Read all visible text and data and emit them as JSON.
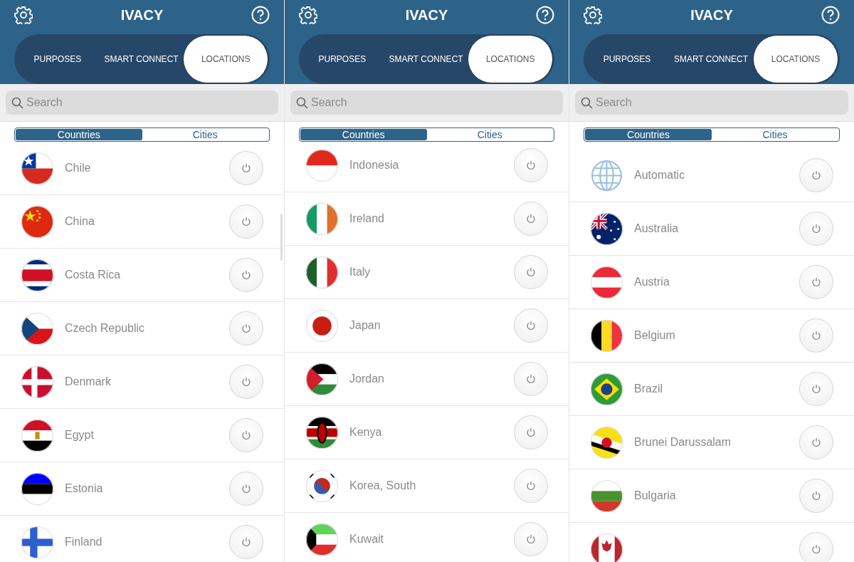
{
  "panels": [
    {
      "title": "IVACY",
      "modes": [
        {
          "label": "PURPOSES",
          "selected": false
        },
        {
          "label": "SMART CONNECT",
          "selected": false
        },
        {
          "label": "LOCATIONS",
          "selected": true
        }
      ],
      "search": {
        "placeholder": "Search"
      },
      "segments": [
        {
          "label": "Countries",
          "selected": true
        },
        {
          "label": "Cities",
          "selected": false
        }
      ],
      "scroll_indicator": true,
      "rows": [
        {
          "name": "Chile",
          "kind": "cl"
        },
        {
          "name": "China",
          "kind": "cn"
        },
        {
          "name": "Costa Rica",
          "kind": "cr"
        },
        {
          "name": "Czech Republic",
          "kind": "cz"
        },
        {
          "name": "Denmark",
          "kind": "dk"
        },
        {
          "name": "Egypt",
          "kind": "eg"
        },
        {
          "name": "Estonia",
          "kind": "ee"
        },
        {
          "name": "Finland",
          "kind": "fi"
        }
      ]
    },
    {
      "title": "IVACY",
      "modes": [
        {
          "label": "PURPOSES",
          "selected": false
        },
        {
          "label": "SMART CONNECT",
          "selected": false
        },
        {
          "label": "LOCATIONS",
          "selected": true
        }
      ],
      "search": {
        "placeholder": "Search"
      },
      "segments": [
        {
          "label": "Countries",
          "selected": true
        },
        {
          "label": "Cities",
          "selected": false
        }
      ],
      "scroll_indicator": false,
      "rows": [
        {
          "name": "Indonesia",
          "kind": "id"
        },
        {
          "name": "Ireland",
          "kind": "ie"
        },
        {
          "name": "Italy",
          "kind": "it"
        },
        {
          "name": "Japan",
          "kind": "jp"
        },
        {
          "name": "Jordan",
          "kind": "jo"
        },
        {
          "name": "Kenya",
          "kind": "ke"
        },
        {
          "name": "Korea, South",
          "kind": "kr"
        },
        {
          "name": "Kuwait",
          "kind": "kw"
        }
      ]
    },
    {
      "title": "IVACY",
      "modes": [
        {
          "label": "PURPOSES",
          "selected": false
        },
        {
          "label": "SMART CONNECT",
          "selected": false
        },
        {
          "label": "LOCATIONS",
          "selected": true
        }
      ],
      "search": {
        "placeholder": "Search"
      },
      "segments": [
        {
          "label": "Countries",
          "selected": true
        },
        {
          "label": "Cities",
          "selected": false
        }
      ],
      "scroll_indicator": false,
      "rows": [
        {
          "name": "Automatic",
          "kind": "globe"
        },
        {
          "name": "Australia",
          "kind": "au"
        },
        {
          "name": "Austria",
          "kind": "at"
        },
        {
          "name": "Belgium",
          "kind": "be"
        },
        {
          "name": "Brazil",
          "kind": "br"
        },
        {
          "name": "Brunei Darussalam",
          "kind": "bn"
        },
        {
          "name": "Bulgaria",
          "kind": "bg"
        },
        {
          "kind": "ca"
        }
      ]
    }
  ]
}
